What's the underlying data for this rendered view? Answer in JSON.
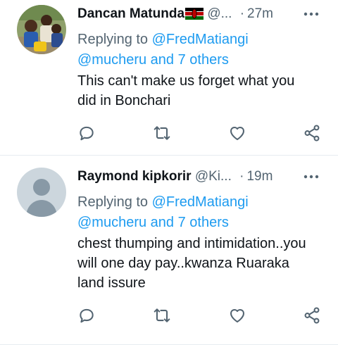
{
  "tweets": [
    {
      "author": "Dancan Matunda",
      "handle": "@...",
      "time": "27m",
      "separator": "·",
      "reply_prefix": "Replying to",
      "reply_to": "@FredMatiangi",
      "reply_others": "@mucheru and 7 others",
      "text": "This can't make us forget what you\ndid in Bonchari",
      "icons": [
        "reply-icon",
        "retweet-icon",
        "like-icon",
        "share-icon",
        "more-icon"
      ]
    },
    {
      "author": "Raymond kipkorir",
      "handle": "@Ki...",
      "time": "19m",
      "separator": "·",
      "reply_prefix": "Replying to",
      "reply_to": "@FredMatiangi",
      "reply_others": "@mucheru and 7 others",
      "text": "chest thumping and intimidation..you\nwill  one day pay..kwanza Ruaraka\nland issure",
      "icons": [
        "reply-icon",
        "retweet-icon",
        "like-icon",
        "share-icon",
        "more-icon"
      ]
    }
  ],
  "colors": {
    "link": "#1d9bf0",
    "muted": "#536471",
    "text": "#0f1419",
    "divider": "#e6ecf0",
    "default_avatar_bg": "#ccd6dd",
    "default_avatar_fg": "#8899a6"
  }
}
